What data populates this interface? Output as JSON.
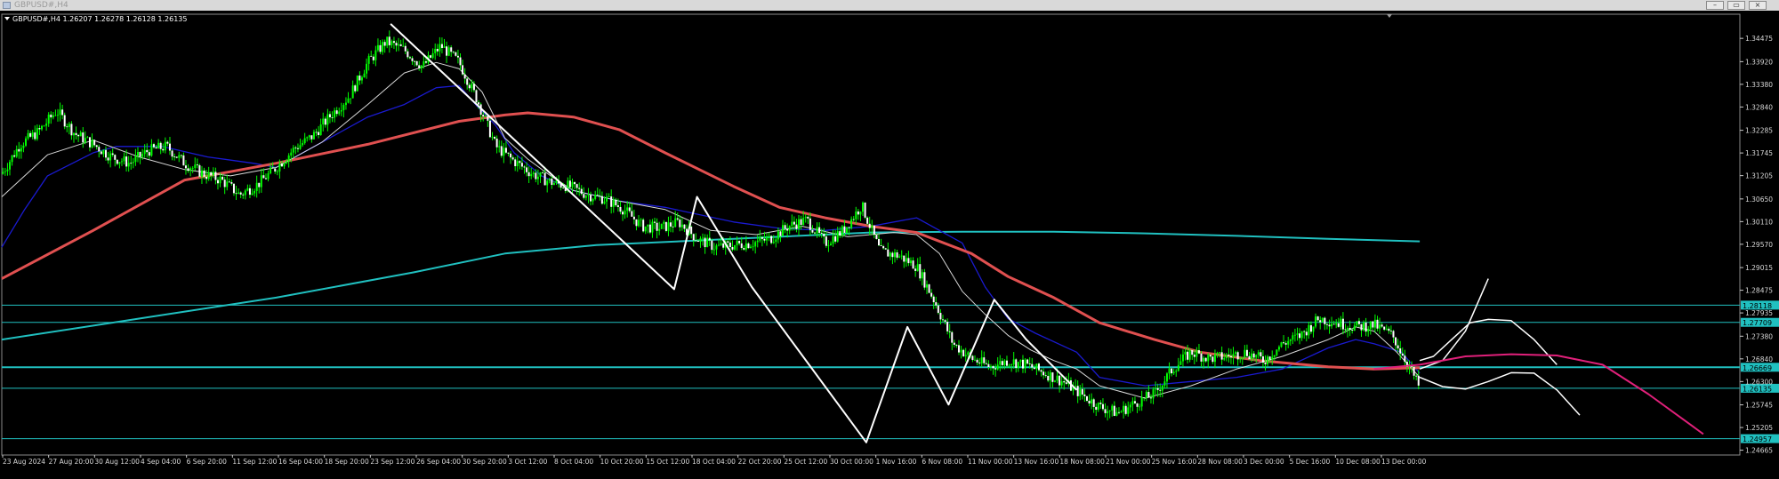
{
  "window": {
    "title": "GBPUSD#,H4",
    "minimize_label": "–",
    "restore_label": "▭",
    "close_label": "×"
  },
  "symbol_info": {
    "symbol": "GBPUSD#,H4",
    "ohlc": "1.26207 1.26278 1.26128 1.26135"
  },
  "colors": {
    "background": "#000000",
    "candles": "#00ff00",
    "bear_bodies": "#ffffff",
    "ma_red": "#e05050",
    "ma_cyan": "#20c0c0",
    "ma_blue": "#1a1ad0",
    "ma_thin": "#d8d8d8",
    "level_lines": "#20c0c0",
    "drawn_lines": "#ffffff",
    "projection_magenta": "#e0207a"
  },
  "chart_data": {
    "type": "line",
    "instrument": "GBPUSD#",
    "timeframe": "H4",
    "ylim": [
      1.2455,
      1.3505
    ],
    "y_ticks": [
      "1.34475",
      "1.33920",
      "1.33380",
      "1.32840",
      "1.32285",
      "1.31745",
      "1.31205",
      "1.30650",
      "1.30110",
      "1.29570",
      "1.29015",
      "1.28475",
      "1.27935",
      "1.27380",
      "1.26840",
      "1.26300",
      "1.25745",
      "1.25205",
      "1.24665"
    ],
    "x_ticks": [
      "23 Aug 2024",
      "27 Aug 20:00",
      "30 Aug 12:00",
      "4 Sep 04:00",
      "6 Sep 20:00",
      "11 Sep 12:00",
      "16 Sep 04:00",
      "18 Sep 20:00",
      "23 Sep 12:00",
      "26 Sep 04:00",
      "30 Sep 20:00",
      "3 Oct 12:00",
      "8 Oct 04:00",
      "10 Oct 20:00",
      "15 Oct 12:00",
      "18 Oct 04:00",
      "22 Oct 20:00",
      "25 Oct 12:00",
      "30 Oct 00:00",
      "1 Nov 16:00",
      "6 Nov 08:00",
      "11 Nov 00:00",
      "13 Nov 16:00",
      "18 Nov 08:00",
      "21 Nov 00:00",
      "25 Nov 16:00",
      "28 Nov 08:00",
      "3 Dec 00:00",
      "5 Dec 16:00",
      "10 Dec 08:00",
      "13 Dec 00:00"
    ],
    "levels": [
      {
        "label": "1.28118",
        "value": 1.2812
      },
      {
        "label": "1.27709",
        "value": 1.2771
      },
      {
        "label": "1.26669",
        "value": 1.2664
      },
      {
        "label": "1.26135",
        "value": 1.2614
      },
      {
        "label": "1.24957",
        "value": 1.2494
      }
    ],
    "series": [
      {
        "kind": "price",
        "x": [
          0,
          4,
          8,
          12,
          16,
          20,
          24,
          28,
          32,
          36,
          40,
          44,
          48,
          52,
          56,
          60,
          64,
          68,
          72,
          76,
          80,
          84,
          88,
          92,
          96,
          100,
          104,
          108,
          112,
          116,
          120,
          124,
          128,
          132,
          136,
          140,
          144,
          148,
          152,
          156,
          160,
          164,
          168,
          172,
          176,
          180,
          184,
          188,
          192,
          196,
          200,
          204,
          208,
          212,
          216,
          220,
          224,
          228,
          232,
          236,
          240,
          244,
          248,
          252,
          256,
          260,
          264,
          268,
          272,
          276,
          280,
          284,
          288,
          292,
          296,
          300,
          304,
          308,
          310
        ],
        "y": [
          1.3125,
          1.3195,
          1.3225,
          1.3275,
          1.322,
          1.3195,
          1.3165,
          1.315,
          1.318,
          1.319,
          1.315,
          1.3125,
          1.311,
          1.3075,
          1.31,
          1.314,
          1.3185,
          1.3215,
          1.3265,
          1.331,
          1.339,
          1.344,
          1.342,
          1.338,
          1.343,
          1.339,
          1.33,
          1.319,
          1.3155,
          1.3125,
          1.3105,
          1.3095,
          1.3075,
          1.3065,
          1.304,
          1.3,
          1.2995,
          1.301,
          1.297,
          1.295,
          1.2955,
          1.296,
          1.297,
          1.3,
          1.3015,
          1.296,
          1.299,
          1.305,
          1.294,
          1.293,
          1.2905,
          1.282,
          1.272,
          1.2685,
          1.2665,
          1.268,
          1.267,
          1.265,
          1.263,
          1.26,
          1.257,
          1.2555,
          1.258,
          1.26,
          1.266,
          1.27,
          1.2685,
          1.269,
          1.27,
          1.268,
          1.272,
          1.274,
          1.278,
          1.277,
          1.276,
          1.2765,
          1.274,
          1.266,
          1.2614
        ]
      },
      {
        "kind": "ma_red",
        "x": [
          0,
          20,
          40,
          60,
          80,
          100,
          110,
          115,
          125,
          135,
          145,
          160,
          170,
          180,
          190,
          200,
          212,
          220,
          230,
          240,
          252,
          262,
          275,
          290,
          300,
          310
        ],
        "y": [
          1.2875,
          1.299,
          1.311,
          1.315,
          1.3195,
          1.325,
          1.3265,
          1.327,
          1.326,
          1.323,
          1.3175,
          1.3095,
          1.3045,
          1.302,
          1.3,
          1.2985,
          1.2935,
          1.288,
          1.283,
          1.277,
          1.273,
          1.27,
          1.268,
          1.2665,
          1.266,
          1.2663
        ]
      },
      {
        "kind": "ma_cyan",
        "x": [
          0,
          30,
          60,
          90,
          110,
          130,
          150,
          170,
          190,
          210,
          230,
          250,
          270,
          290,
          310
        ],
        "y": [
          1.273,
          1.278,
          1.283,
          1.289,
          1.2935,
          1.2955,
          1.2965,
          1.2975,
          1.2985,
          1.2987,
          1.2987,
          1.2983,
          1.2977,
          1.297,
          1.2964
        ]
      },
      {
        "kind": "ma_blue",
        "x": [
          0,
          5,
          10,
          20,
          25,
          35,
          45,
          55,
          60,
          70,
          80,
          88,
          95,
          100,
          104,
          108,
          112,
          118,
          125,
          135,
          145,
          160,
          170,
          180,
          190,
          200,
          210,
          215,
          220,
          226,
          235,
          240,
          250,
          260,
          270,
          280,
          290,
          296,
          300,
          306,
          310
        ],
        "y": [
          1.295,
          1.304,
          1.312,
          1.3175,
          1.319,
          1.319,
          1.3165,
          1.315,
          1.314,
          1.32,
          1.326,
          1.329,
          1.333,
          1.3335,
          1.3285,
          1.324,
          1.3175,
          1.312,
          1.3085,
          1.306,
          1.3045,
          1.301,
          1.2995,
          1.299,
          1.3,
          1.302,
          1.296,
          1.2855,
          1.278,
          1.2745,
          1.27,
          1.264,
          1.262,
          1.263,
          1.264,
          1.266,
          1.271,
          1.273,
          1.272,
          1.27,
          1.265
        ]
      },
      {
        "kind": "ma_thin",
        "x": [
          0,
          10,
          20,
          30,
          40,
          50,
          60,
          70,
          80,
          88,
          95,
          100,
          105,
          110,
          115,
          120,
          125,
          135,
          145,
          155,
          165,
          175,
          185,
          195,
          200,
          205,
          210,
          215,
          220,
          225,
          230,
          235,
          240,
          250,
          260,
          270,
          280,
          290,
          296,
          300,
          305,
          310
        ],
        "y": [
          1.307,
          1.317,
          1.3205,
          1.3165,
          1.3135,
          1.312,
          1.314,
          1.32,
          1.329,
          1.3365,
          1.339,
          1.3375,
          1.332,
          1.321,
          1.316,
          1.312,
          1.3085,
          1.306,
          1.304,
          1.299,
          1.298,
          1.3,
          1.2975,
          1.2985,
          1.298,
          1.2935,
          1.2845,
          1.279,
          1.274,
          1.2705,
          1.268,
          1.266,
          1.262,
          1.259,
          1.262,
          1.266,
          1.269,
          1.273,
          1.276,
          1.275,
          1.27,
          1.264
        ]
      },
      {
        "kind": "trendline_white",
        "x": [
          85,
          147,
          152,
          164,
          189,
          198,
          207,
          217,
          224,
          235
        ],
        "y": [
          1.3482,
          1.285,
          1.307,
          1.2855,
          1.2485,
          1.276,
          1.2575,
          1.2825,
          1.273,
          1.261
        ]
      },
      {
        "kind": "projection_white_rise",
        "x": [
          310,
          315,
          320,
          325
        ],
        "y": [
          1.266,
          1.268,
          1.275,
          1.2875
        ]
      },
      {
        "kind": "projection_white_arc_upper",
        "x": [
          310,
          313,
          317,
          321,
          325,
          330,
          335,
          340
        ],
        "y": [
          1.268,
          1.269,
          1.273,
          1.277,
          1.2778,
          1.2775,
          1.273,
          1.267
        ]
      },
      {
        "kind": "projection_white_arc_lower",
        "x": [
          310,
          315,
          320,
          325,
          330,
          335,
          340,
          345
        ],
        "y": [
          1.264,
          1.2618,
          1.2612,
          1.263,
          1.2651,
          1.265,
          1.261,
          1.255
        ]
      },
      {
        "kind": "projection_magenta",
        "x": [
          300,
          310,
          320,
          330,
          340,
          350,
          360,
          372
        ],
        "y": [
          1.266,
          1.267,
          1.269,
          1.2695,
          1.2692,
          1.267,
          1.26,
          1.2505
        ]
      }
    ]
  }
}
